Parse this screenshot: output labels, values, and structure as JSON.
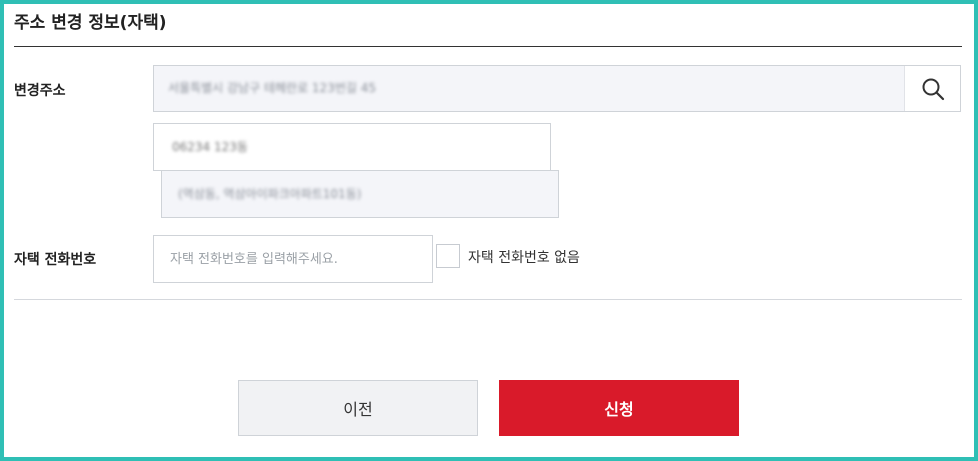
{
  "section": {
    "title": "주소 변경 정보(자택)"
  },
  "address": {
    "label": "변경주소",
    "main_value": "서울특별시 강남구 테헤란로 123번길 45",
    "zip_value": "06234 123동",
    "detail_value": "(역삼동, 역삼아이파크아파트101동)",
    "search_icon": "search-icon"
  },
  "phone": {
    "label": "자택 전화번호",
    "placeholder": "자택 전화번호를 입력해주세요.",
    "value": "",
    "no_phone_label": "자택 전화번호 없음",
    "no_phone_checked": false
  },
  "buttons": {
    "prev_label": "이전",
    "apply_label": "신청"
  },
  "colors": {
    "accent": "#d91a2a",
    "frame": "#2fbfb5",
    "input_bg": "#f4f5f9"
  }
}
